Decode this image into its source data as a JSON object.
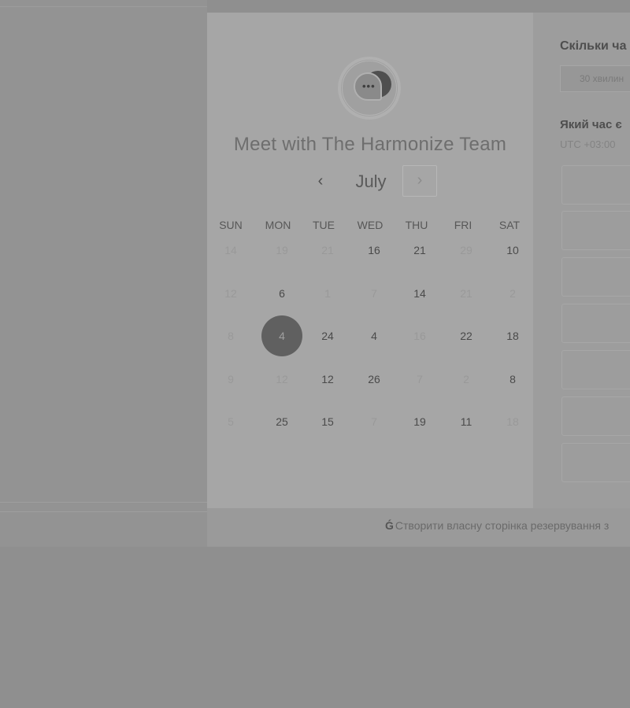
{
  "calendar": {
    "title": "Meet with The Harmonize Team",
    "month": "July",
    "prev_icon": "‹",
    "next_icon": "›",
    "weekdays": [
      "SUN",
      "MON",
      "TUE",
      "WED",
      "THU",
      "FRI",
      "SAT"
    ],
    "weeks": [
      [
        {
          "label": "14",
          "available": false
        },
        {
          "label": "19",
          "available": false
        },
        {
          "label": "21",
          "available": false
        },
        {
          "label": "16",
          "available": true
        },
        {
          "label": "21",
          "available": true
        },
        {
          "label": "29",
          "available": false
        },
        {
          "label": "10",
          "available": true
        }
      ],
      [
        {
          "label": "12",
          "available": false
        },
        {
          "label": "6",
          "available": true
        },
        {
          "label": "1",
          "available": false
        },
        {
          "label": "7",
          "available": false
        },
        {
          "label": "14",
          "available": true
        },
        {
          "label": "21",
          "available": false
        },
        {
          "label": "2",
          "available": false
        }
      ],
      [
        {
          "label": "8",
          "available": false
        },
        {
          "label": "4",
          "available": true,
          "selected": true
        },
        {
          "label": "24",
          "available": true
        },
        {
          "label": "4",
          "available": true
        },
        {
          "label": "16",
          "available": false
        },
        {
          "label": "22",
          "available": true
        },
        {
          "label": "18",
          "available": true
        }
      ],
      [
        {
          "label": "9",
          "available": false
        },
        {
          "label": "12",
          "available": false
        },
        {
          "label": "12",
          "available": true
        },
        {
          "label": "26",
          "available": true
        },
        {
          "label": "7",
          "available": false
        },
        {
          "label": "2",
          "available": false
        },
        {
          "label": "8",
          "available": true
        }
      ],
      [
        {
          "label": "5",
          "available": false
        },
        {
          "label": "25",
          "available": true
        },
        {
          "label": "15",
          "available": true
        },
        {
          "label": "7",
          "available": false
        },
        {
          "label": "19",
          "available": true
        },
        {
          "label": "11",
          "available": true
        },
        {
          "label": "18",
          "available": false
        }
      ]
    ]
  },
  "right_panel": {
    "duration_title": "Скільки ча",
    "duration_value": "30 хвилин",
    "time_question": "Який час є",
    "timezone": "UTC +03:00"
  },
  "footer": {
    "link_text": "Створити власну сторінка резервування з"
  }
}
